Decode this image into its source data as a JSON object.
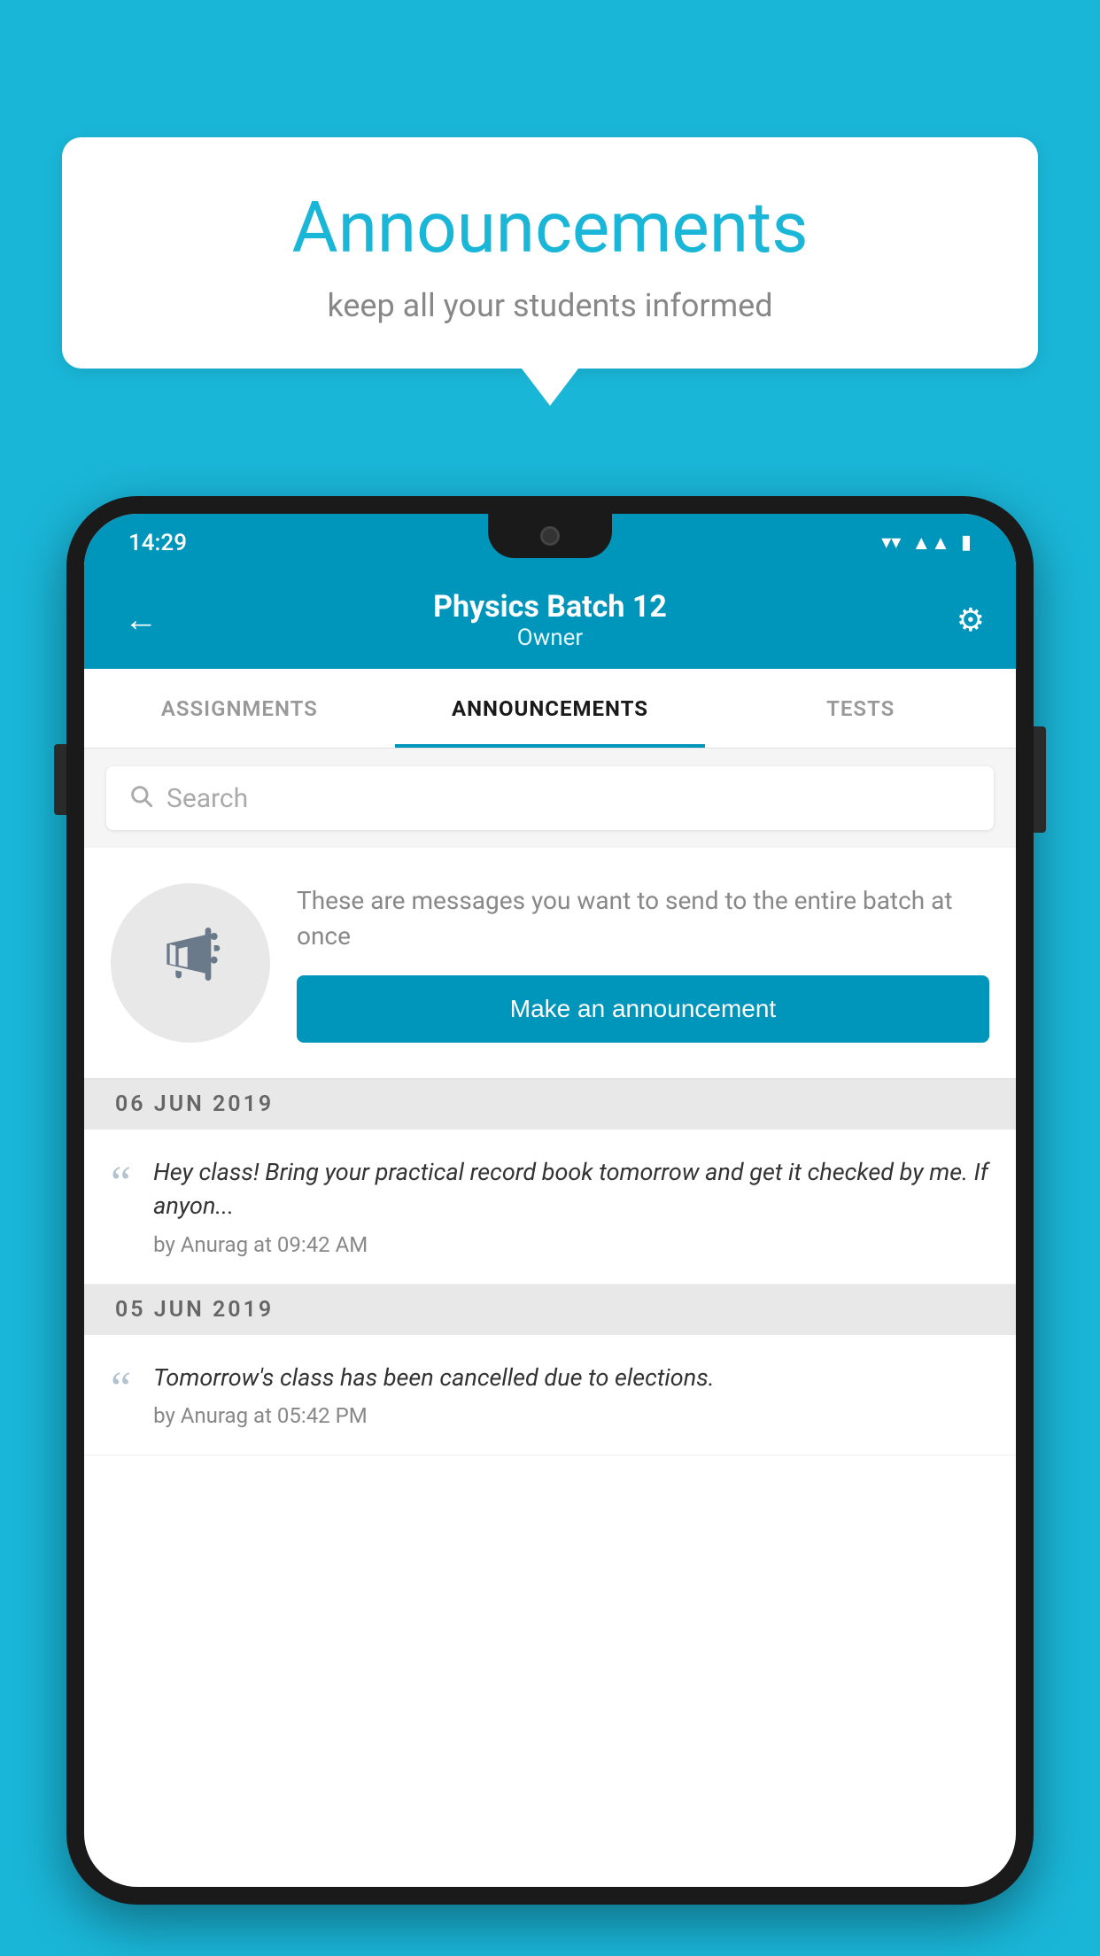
{
  "background_color": "#1ab6d8",
  "speech_bubble": {
    "title": "Announcements",
    "subtitle": "keep all your students informed"
  },
  "phone": {
    "status_bar": {
      "time": "14:29",
      "wifi": "▼",
      "signal": "▲",
      "battery": "▮"
    },
    "app_bar": {
      "back_label": "←",
      "title": "Physics Batch 12",
      "subtitle": "Owner",
      "settings_label": "⚙"
    },
    "tabs": [
      {
        "label": "ASSIGNMENTS",
        "active": false
      },
      {
        "label": "ANNOUNCEMENTS",
        "active": true
      },
      {
        "label": "TESTS",
        "active": false
      }
    ],
    "search": {
      "placeholder": "Search"
    },
    "announcement_prompt": {
      "description": "These are messages you want to send to the entire batch at once",
      "button_label": "Make an announcement"
    },
    "announcements": [
      {
        "date": "06  JUN  2019",
        "text": "Hey class! Bring your practical record book tomorrow and get it checked by me. If anyon...",
        "meta": "by Anurag at 09:42 AM"
      },
      {
        "date": "05  JUN  2019",
        "text": "Tomorrow's class has been cancelled due to elections.",
        "meta": "by Anurag at 05:42 PM"
      }
    ]
  }
}
